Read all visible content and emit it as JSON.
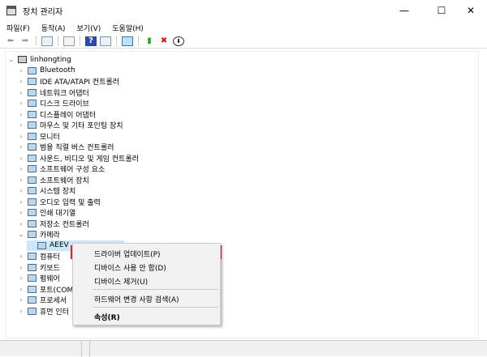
{
  "window": {
    "title": "장치 관리자",
    "minimize": "—",
    "maximize": "☐",
    "close": "✕"
  },
  "menu": [
    "파일(F)",
    "동작(A)",
    "보기(V)",
    "도움말(H)"
  ],
  "toolbar_icons": [
    "back-icon",
    "forward-icon",
    "show-hide-console-tree-icon",
    "properties-icon",
    "help-icon",
    "action-pane-icon",
    "scan-hardware-icon",
    "update-driver-icon",
    "uninstall-icon",
    "disable-icon"
  ],
  "tree": {
    "root": "linhongting",
    "items": [
      "Bluetooth",
      "IDE ATA/ATAPI 컨트롤러",
      "네트워크 어댑터",
      "디스크 드라이브",
      "디스플레이 어댑터",
      "마우스 및 기타 포인팅 장치",
      "모니터",
      "범용 직렬 버스 컨트롤러",
      "사운드, 비디오 및 게임 컨트롤러",
      "소프트웨어 구성 요소",
      "소프트웨어 장치",
      "시스템 장치",
      "오디오 입력 및 출력",
      "인쇄 대기열",
      "저장소 컨트롤러",
      "카메라"
    ],
    "camera_child": "AEEV",
    "after": [
      "컴퓨터",
      "키보드",
      "펌웨어",
      "포트(COM",
      "프로세서",
      "휴먼 인터"
    ]
  },
  "context_menu": {
    "items": [
      "드라이버 업데이트(P)",
      "디바이스 사용 안 함(D)",
      "디바이스 제거(U)",
      "하드웨어 변경 사항 검색(A)",
      "속성(R)"
    ],
    "highlight_color": "#e8202a"
  }
}
